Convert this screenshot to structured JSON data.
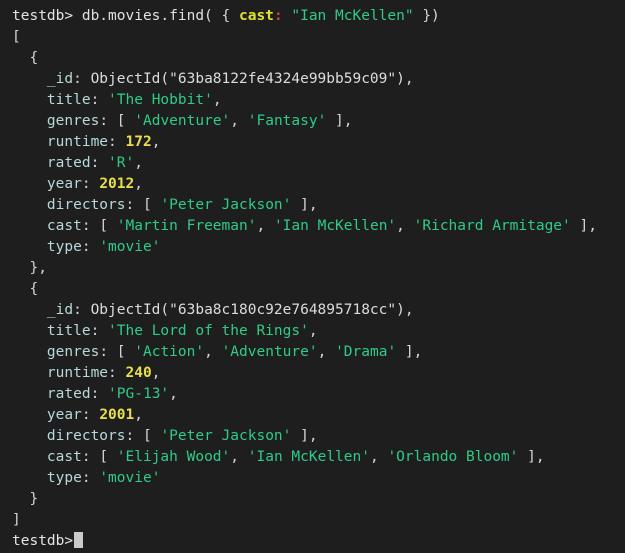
{
  "terminal": {
    "background_color": "#1e1e1e",
    "prompt": "testdb>",
    "command": " db.movies.find( ",
    "query": {
      "open_brace": "{ ",
      "key": "cast",
      "colon": ":",
      "value": " \"Ian McKellen\"",
      "close": " })"
    },
    "result_open": "[",
    "result_close": "]",
    "documents": [
      {
        "open": "{",
        "fields": [
          {
            "key": "_id",
            "value": "ObjectId(\"63ba8122fe4324e99bb59c09\")",
            "type": "oid",
            "trailing": ","
          },
          {
            "key": "title",
            "value": "'The Hobbit'",
            "type": "str",
            "trailing": ","
          },
          {
            "key": "genres",
            "value": "[ 'Adventure', 'Fantasy' ]",
            "type": "array",
            "items": [
              "'Adventure'",
              "'Fantasy'"
            ],
            "trailing": ","
          },
          {
            "key": "runtime",
            "value": "172",
            "type": "num",
            "trailing": ","
          },
          {
            "key": "rated",
            "value": "'R'",
            "type": "str",
            "trailing": ","
          },
          {
            "key": "year",
            "value": "2012",
            "type": "num",
            "trailing": ","
          },
          {
            "key": "directors",
            "value": "[ 'Peter Jackson' ]",
            "type": "array",
            "items": [
              "'Peter Jackson'"
            ],
            "trailing": ","
          },
          {
            "key": "cast",
            "value": "[ 'Martin Freeman', 'Ian McKellen', 'Richard Armitage' ]",
            "type": "array",
            "items": [
              "'Martin Freeman'",
              "'Ian McKellen'",
              "'Richard Armitage'"
            ],
            "trailing": ","
          },
          {
            "key": "type",
            "value": "'movie'",
            "type": "str",
            "trailing": ""
          }
        ],
        "close": "},"
      },
      {
        "open": "{",
        "fields": [
          {
            "key": "_id",
            "value": "ObjectId(\"63ba8c180c92e764895718cc\")",
            "type": "oid",
            "trailing": ","
          },
          {
            "key": "title",
            "value": "'The Lord of the Rings'",
            "type": "str",
            "trailing": ","
          },
          {
            "key": "genres",
            "value": "[ 'Action', 'Adventure', 'Drama' ]",
            "type": "array",
            "items": [
              "'Action'",
              "'Adventure'",
              "'Drama'"
            ],
            "trailing": ","
          },
          {
            "key": "runtime",
            "value": "240",
            "type": "num",
            "trailing": ","
          },
          {
            "key": "rated",
            "value": "'PG-13'",
            "type": "str",
            "trailing": ","
          },
          {
            "key": "year",
            "value": "2001",
            "type": "num",
            "trailing": ","
          },
          {
            "key": "directors",
            "value": "[ 'Peter Jackson' ]",
            "type": "array",
            "items": [
              "'Peter Jackson'"
            ],
            "trailing": ","
          },
          {
            "key": "cast",
            "value": "[ 'Elijah Wood', 'Ian McKellen', 'Orlando Bloom' ]",
            "type": "array",
            "items": [
              "'Elijah Wood'",
              "'Ian McKellen'",
              "'Orlando Bloom'"
            ],
            "trailing": ","
          },
          {
            "key": "type",
            "value": "'movie'",
            "type": "str",
            "trailing": ""
          }
        ],
        "close": "}"
      }
    ],
    "final_prompt": "testdb>"
  },
  "colors": {
    "background": "#1e1e1e",
    "default_text": "#d6d6d6",
    "key": "#b8d8d8",
    "string": "#2ecc87",
    "number": "#e8e04a",
    "query_key": "#e3e02f",
    "query_colon": "#c94b3a",
    "cursor": "#c9c9c9"
  }
}
